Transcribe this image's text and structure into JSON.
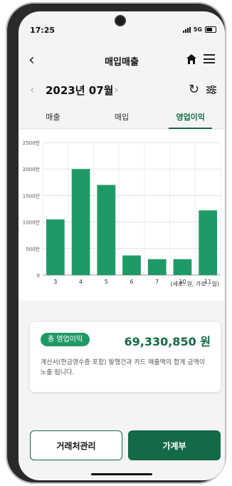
{
  "status_bar": {
    "time": "17:25",
    "network": "5G"
  },
  "header": {
    "title": "매입매출"
  },
  "period": {
    "label": "2023년 07월"
  },
  "tabs": [
    {
      "label": "매출"
    },
    {
      "label": "매입"
    },
    {
      "label": "영업이익",
      "active": true
    }
  ],
  "chart_data": {
    "type": "bar",
    "categories": [
      "3",
      "4",
      "5",
      "6",
      "7",
      "10",
      "11"
    ],
    "values": [
      1050,
      2000,
      1700,
      370,
      300,
      300,
      1220
    ],
    "ylim": [
      0,
      2500
    ],
    "y_ticks": [
      "0",
      "500만",
      "1000만",
      "1500만",
      "2000만",
      "2500만"
    ],
    "grid": true,
    "color": "#1f9a67",
    "unit_note": "(세로: 원, 가로 : 일)"
  },
  "summary": {
    "badge": "총 영업이익",
    "amount": "69,330,850 원",
    "description": "계산서(현금영수증 포함) 발행건과 카드 매출액의 합계 금액이 노출 됩니다."
  },
  "buttons": {
    "left": "거래처관리",
    "right": "가계부"
  }
}
